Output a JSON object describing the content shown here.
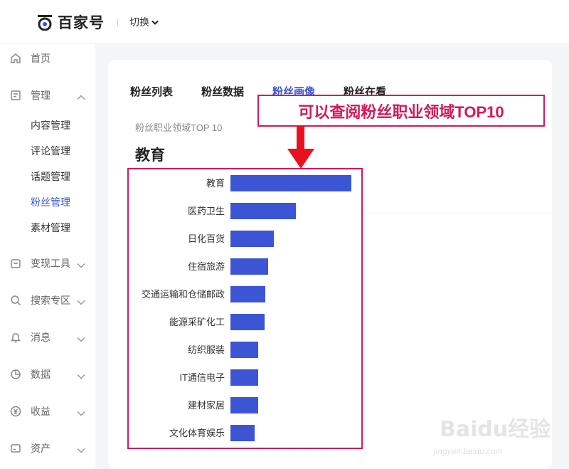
{
  "header": {
    "logo_text": "百家号",
    "switch_label": "切换"
  },
  "sidebar": {
    "items": [
      {
        "label": "首页",
        "icon": "home-icon"
      },
      {
        "label": "管理",
        "icon": "document-icon"
      },
      {
        "label": "变现工具",
        "icon": "wallet-icon"
      },
      {
        "label": "搜索专区",
        "icon": "search-icon"
      },
      {
        "label": "消息",
        "icon": "bell-icon"
      },
      {
        "label": "数据",
        "icon": "pie-chart-icon"
      },
      {
        "label": "收益",
        "icon": "yen-icon"
      },
      {
        "label": "资产",
        "icon": "card-icon"
      }
    ],
    "sub_items": [
      {
        "label": "内容管理"
      },
      {
        "label": "评论管理"
      },
      {
        "label": "话题管理"
      },
      {
        "label": "粉丝管理"
      },
      {
        "label": "素材管理"
      }
    ]
  },
  "tabs": [
    {
      "label": "粉丝列表"
    },
    {
      "label": "粉丝数据"
    },
    {
      "label": "粉丝画像"
    },
    {
      "label": "粉丝在看"
    }
  ],
  "section": {
    "title": "粉丝职业领域TOP 10",
    "top_field": "教育"
  },
  "chart_data": {
    "type": "bar",
    "orientation": "horizontal",
    "categories": [
      "教育",
      "医药卫生",
      "日化百货",
      "住宿旅游",
      "交通运输和仓储邮政",
      "能源采矿化工",
      "纺织服装",
      "IT通信电子",
      "建材家居",
      "文化体育娱乐"
    ],
    "values": [
      100,
      54,
      36,
      31,
      29,
      28,
      23,
      23,
      23,
      20
    ],
    "bar_color": "#3b55d4"
  },
  "annotation": {
    "callout_text": "可以查阅粉丝职业领域TOP10",
    "color": "#d6185a"
  },
  "watermark": {
    "main": "Baidu经验",
    "sub": "jingyan.baidu.com"
  }
}
